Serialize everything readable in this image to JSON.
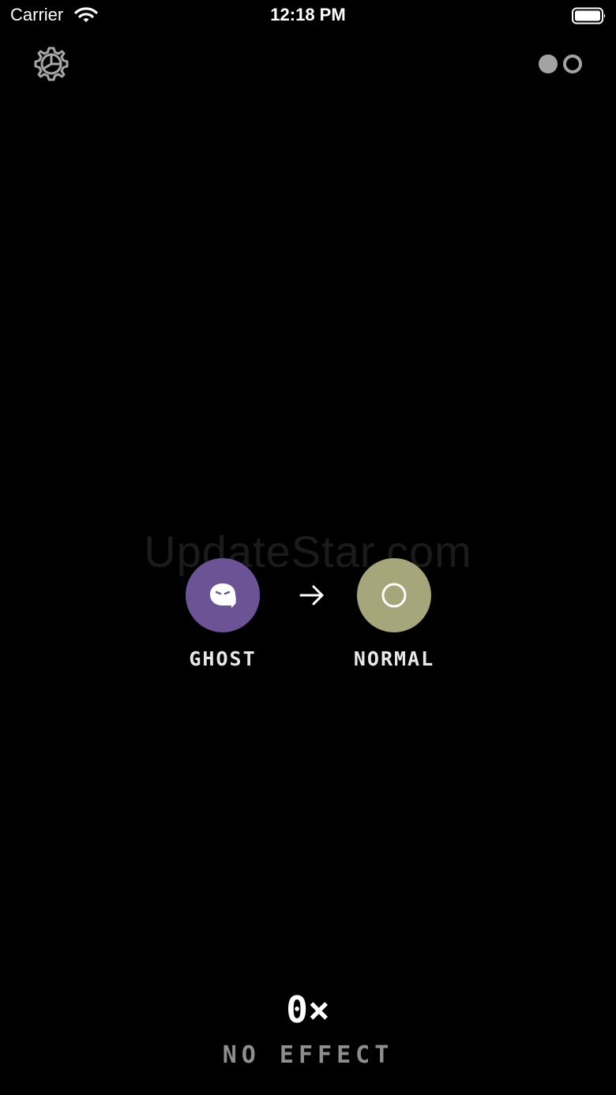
{
  "status_bar": {
    "carrier": "Carrier",
    "time": "12:18 PM",
    "icons": [
      "wifi-icon",
      "battery-icon"
    ]
  },
  "toolbar": {
    "settings_icon": "gear-icon",
    "mode_toggle_icon": "dual-circle-toggle-icon"
  },
  "watermark": "UpdateStar.com",
  "transition": {
    "from": {
      "label": "GHOST",
      "icon": "ghost-icon",
      "color": "#6b5396"
    },
    "arrow_icon": "arrow-right-icon",
    "to": {
      "label": "NORMAL",
      "icon": "ring-icon",
      "color": "#a5a679"
    }
  },
  "readout": {
    "multiplier": "0×",
    "status": "NO EFFECT"
  }
}
